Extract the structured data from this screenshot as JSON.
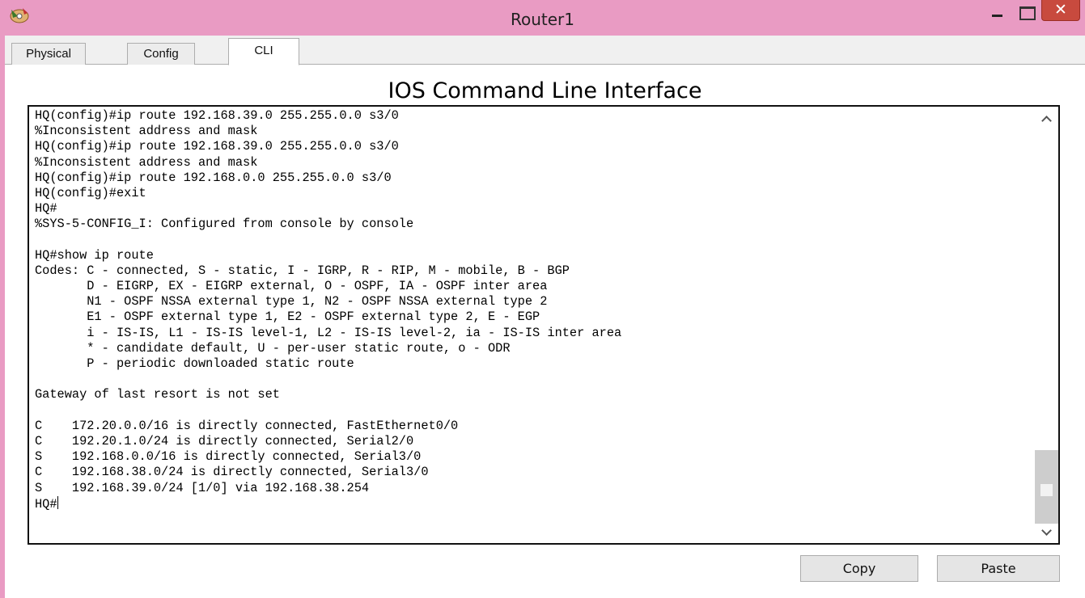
{
  "window": {
    "title": "Router1",
    "close_glyph": "✕"
  },
  "tabs": [
    {
      "label": "Physical"
    },
    {
      "label": "Config"
    },
    {
      "label": "CLI"
    }
  ],
  "cli": {
    "heading": "IOS Command Line Interface",
    "lines": [
      "HQ(config)#ip route 192.168.39.0 255.255.0.0 s3/0",
      "%Inconsistent address and mask",
      "HQ(config)#ip route 192.168.39.0 255.255.0.0 s3/0",
      "%Inconsistent address and mask",
      "HQ(config)#ip route 192.168.0.0 255.255.0.0 s3/0",
      "HQ(config)#exit",
      "HQ#",
      "%SYS-5-CONFIG_I: Configured from console by console",
      "",
      "HQ#show ip route",
      "Codes: C - connected, S - static, I - IGRP, R - RIP, M - mobile, B - BGP",
      "       D - EIGRP, EX - EIGRP external, O - OSPF, IA - OSPF inter area",
      "       N1 - OSPF NSSA external type 1, N2 - OSPF NSSA external type 2",
      "       E1 - OSPF external type 1, E2 - OSPF external type 2, E - EGP",
      "       i - IS-IS, L1 - IS-IS level-1, L2 - IS-IS level-2, ia - IS-IS inter area",
      "       * - candidate default, U - per-user static route, o - ODR",
      "       P - periodic downloaded static route",
      "",
      "Gateway of last resort is not set",
      "",
      "C    172.20.0.0/16 is directly connected, FastEthernet0/0",
      "C    192.20.1.0/24 is directly connected, Serial2/0",
      "S    192.168.0.0/16 is directly connected, Serial3/0",
      "C    192.168.38.0/24 is directly connected, Serial3/0",
      "S    192.168.39.0/24 [1/0] via 192.168.38.254"
    ],
    "prompt": "HQ#"
  },
  "buttons": {
    "copy": "Copy",
    "paste": "Paste"
  },
  "icons": {
    "app": "packet-tracer-router-icon",
    "minimize": "minimize-icon",
    "maximize": "maximize-icon",
    "close": "close-icon",
    "scroll_up": "chevron-up-icon",
    "scroll_down": "chevron-down-icon"
  }
}
